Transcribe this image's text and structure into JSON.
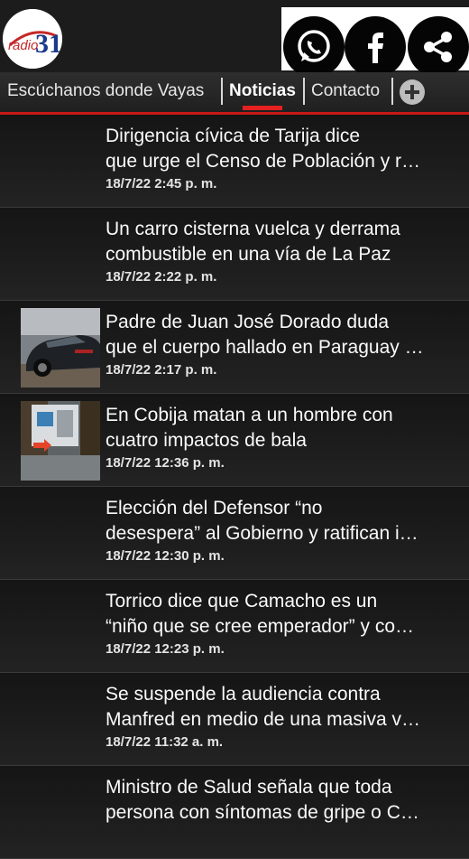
{
  "header": {
    "logo_text": "radio 31",
    "social_icons": [
      "whatsapp-icon",
      "facebook-icon",
      "share-icon"
    ]
  },
  "tabs": [
    {
      "label": "Escúchanos donde Vayas",
      "active": false
    },
    {
      "label": "Noticias",
      "active": true
    },
    {
      "label": "Contacto",
      "active": false
    }
  ],
  "add_tab_icon": "plus-circle-icon",
  "accent_color": "#e52020",
  "news": [
    {
      "line1": "Dirigencia cívica de Tarija dice",
      "line2": "que urge el Censo de Población y r…",
      "date": "18/7/22 2:45 p. m.",
      "thumb": null
    },
    {
      "line1": "Un carro cisterna vuelca y derrama",
      "line2": "combustible en una vía de La Paz",
      "date": "18/7/22 2:22 p. m.",
      "thumb": null
    },
    {
      "line1": "Padre de Juan José Dorado duda",
      "line2": "que el cuerpo hallado en Paraguay …",
      "date": "18/7/22 2:17 p. m.",
      "thumb": "car-photo"
    },
    {
      "line1": "En Cobija matan a un hombre con",
      "line2": "cuatro impactos de bala",
      "date": "18/7/22 12:36 p. m.",
      "thumb": "street-photo"
    },
    {
      "line1": "Elección del Defensor “no",
      "line2": "desespera” al Gobierno y ratifican i…",
      "date": "18/7/22 12:30 p. m.",
      "thumb": null
    },
    {
      "line1": "Torrico dice que Camacho es un",
      "line2": "“niño que se cree emperador” y co…",
      "date": "18/7/22 12:23 p. m.",
      "thumb": null
    },
    {
      "line1": "Se suspende la audiencia contra",
      "line2": "Manfred en medio de una masiva v…",
      "date": "18/7/22 11:32 a. m.",
      "thumb": null
    },
    {
      "line1": "Ministro de Salud señala que toda",
      "line2": "persona con síntomas de gripe o C…",
      "date": "",
      "thumb": null
    }
  ]
}
